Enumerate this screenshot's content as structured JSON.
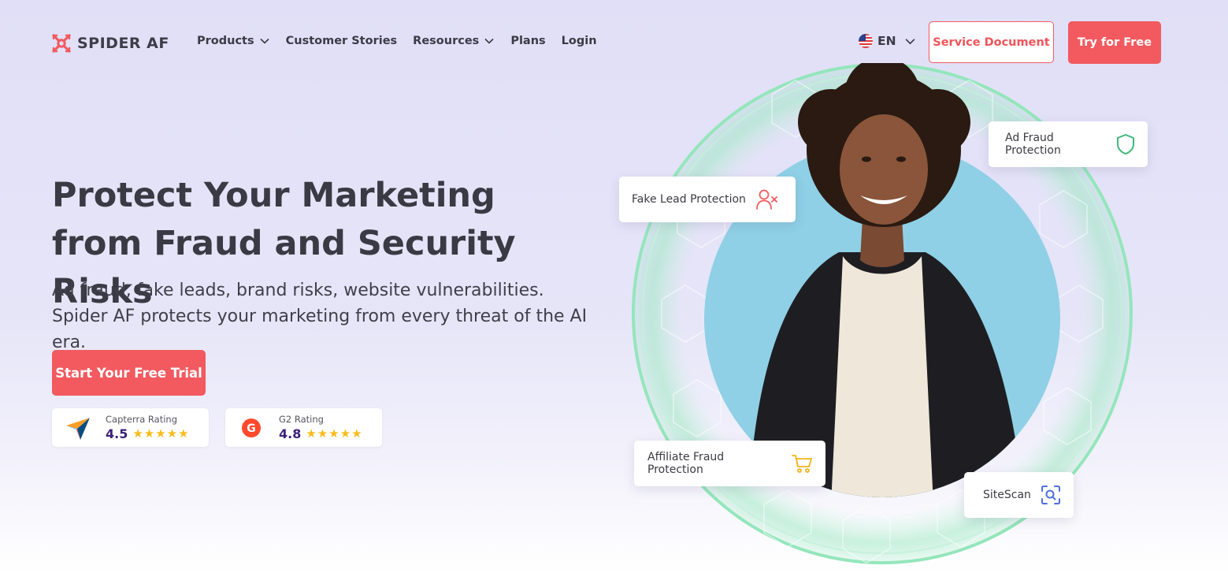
{
  "brand": {
    "name": "SPIDER AF",
    "accent": "#f25a5f"
  },
  "nav": {
    "items": [
      {
        "label": "Products",
        "has_dropdown": true
      },
      {
        "label": "Customer Stories",
        "has_dropdown": false
      },
      {
        "label": "Resources",
        "has_dropdown": true
      },
      {
        "label": "Plans",
        "has_dropdown": false
      },
      {
        "label": "Login",
        "has_dropdown": false
      }
    ],
    "language": {
      "label": "EN",
      "icon": "us-flag-icon"
    },
    "service_document": "Service Document",
    "try_free": "Try for Free"
  },
  "hero": {
    "headline_line1": "Protect Your Marketing",
    "headline_line2": "from Fraud and Security Risks",
    "subtext": "Ad fraud, fake leads, brand risks, website vulnerabilities. Spider AF protects your marketing from every threat of the AI era.",
    "cta": "Start Your Free Trial",
    "ratings": [
      {
        "label": "Capterra Rating",
        "score": "4.5",
        "icon": "capterra-logo-icon"
      },
      {
        "label": "G2 Rating",
        "score": "4.8",
        "icon": "g2-logo-icon"
      }
    ]
  },
  "features": {
    "ad_fraud": {
      "label": "Ad Fraud Protection",
      "icon": "shield-icon",
      "color": "#3fb87a"
    },
    "fake_lead": {
      "label": "Fake Lead Protection",
      "icon": "user-x-icon",
      "color": "#f25a5f"
    },
    "affiliate": {
      "label": "Affiliate Fraud Protection",
      "icon": "cart-icon",
      "color": "#f2b21b"
    },
    "sitescan": {
      "label": "SiteScan",
      "icon": "scan-search-icon",
      "color": "#4f6fe0"
    }
  }
}
